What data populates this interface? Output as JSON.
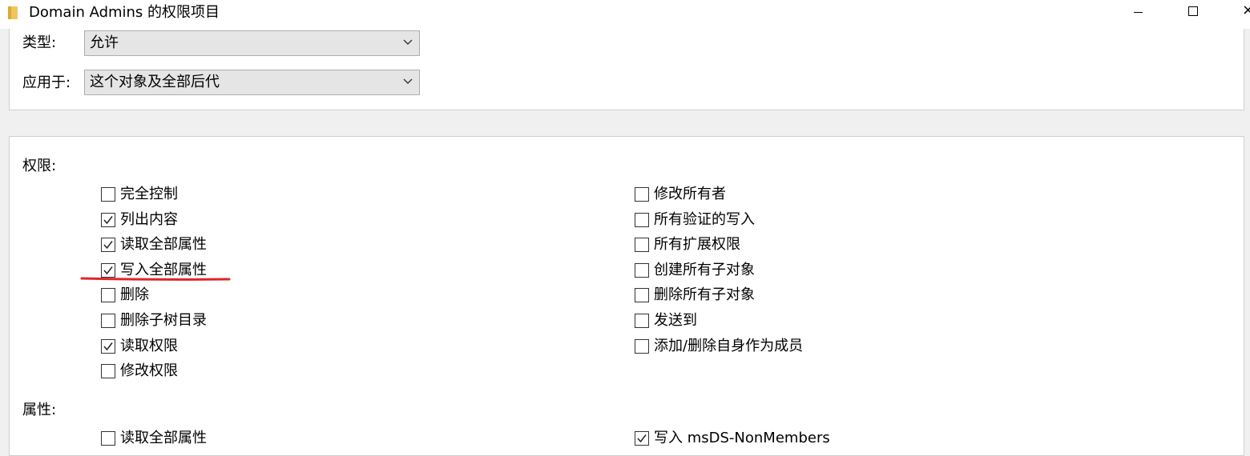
{
  "window": {
    "title": "Domain Admins 的权限项目",
    "icon": "folder-icon",
    "controls": [
      "minimize",
      "maximize",
      "close"
    ],
    "close_glyph": "×"
  },
  "settings": {
    "type_label": "类型:",
    "type_value": "允许",
    "applies_label": "应用于:",
    "applies_value": "这个对象及全部后代"
  },
  "permissions": {
    "section_label": "权限:",
    "left": [
      {
        "label": "完全控制",
        "checked": false
      },
      {
        "label": "列出内容",
        "checked": true
      },
      {
        "label": "读取全部属性",
        "checked": true
      },
      {
        "label": "写入全部属性",
        "checked": true
      },
      {
        "label": "删除",
        "checked": false
      },
      {
        "label": "删除子树目录",
        "checked": false
      },
      {
        "label": "读取权限",
        "checked": true
      },
      {
        "label": "修改权限",
        "checked": false
      }
    ],
    "right": [
      {
        "label": "修改所有者",
        "checked": false
      },
      {
        "label": "所有验证的写入",
        "checked": false
      },
      {
        "label": "所有扩展权限",
        "checked": false
      },
      {
        "label": "创建所有子对象",
        "checked": false
      },
      {
        "label": "删除所有子对象",
        "checked": false
      },
      {
        "label": "发送到",
        "checked": false
      },
      {
        "label": "添加/删除自身作为成员",
        "checked": false
      }
    ]
  },
  "properties": {
    "section_label": "属性:",
    "left": [
      {
        "label": "读取全部属性",
        "checked": false
      }
    ],
    "right": [
      {
        "label": "写入 msDS-NonMembers",
        "checked": true
      }
    ]
  },
  "colors": {
    "annotation": "#e0242a",
    "folder": "#f2c55c"
  }
}
